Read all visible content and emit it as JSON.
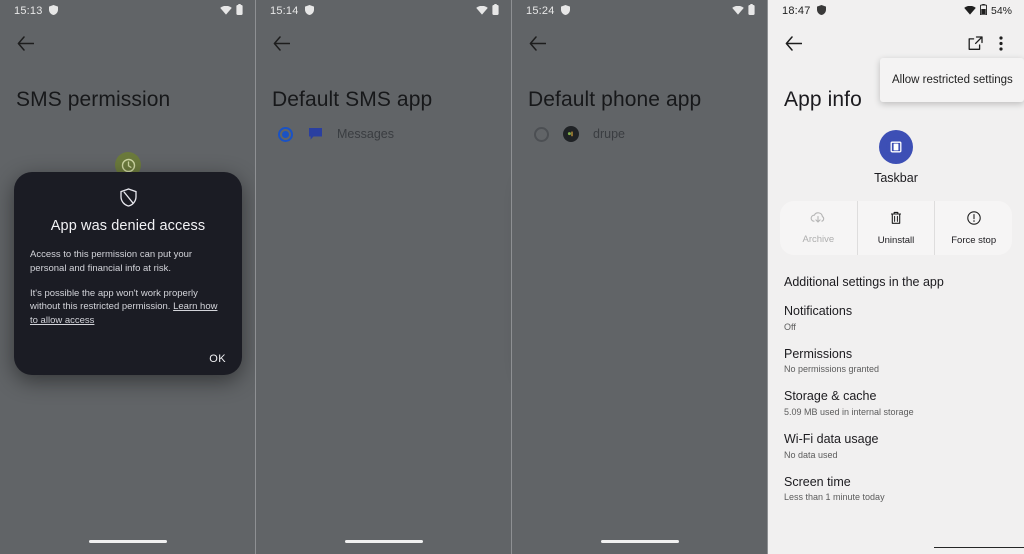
{
  "dialog": {
    "title": "App was denied access",
    "paragraph1": "Access to this permission can put your personal and financial info at risk.",
    "paragraph2_pre": "It's possible the app won't work properly without this restricted permission. ",
    "link": "Learn how to allow access",
    "ok_label": "OK"
  },
  "panels": [
    {
      "status": {
        "time": "15:13",
        "battery_pct": ""
      },
      "title": "SMS permission"
    },
    {
      "status": {
        "time": "15:14",
        "battery_pct": ""
      },
      "title": "Default SMS app",
      "option": {
        "label": "Messages",
        "selected": true
      }
    },
    {
      "status": {
        "time": "15:24",
        "battery_pct": ""
      },
      "title": "Default phone app",
      "option": {
        "label": "drupe",
        "selected": false
      }
    },
    {
      "status": {
        "time": "18:47",
        "battery_pct": "54%"
      },
      "title": "App info",
      "popup_menu_item": "Allow restricted settings",
      "app_name": "Taskbar",
      "actions": [
        {
          "label": "Archive",
          "disabled": true
        },
        {
          "label": "Uninstall",
          "disabled": false
        },
        {
          "label": "Force stop",
          "disabled": false
        }
      ],
      "section_header": "Additional settings in the app",
      "settings": [
        {
          "title": "Notifications",
          "subtitle": "Off"
        },
        {
          "title": "Permissions",
          "subtitle": "No permissions granted"
        },
        {
          "title": "Storage & cache",
          "subtitle": "5.09 MB used in internal storage"
        },
        {
          "title": "Wi-Fi data usage",
          "subtitle": "No data used"
        },
        {
          "title": "Screen time",
          "subtitle": "Less than 1 minute today"
        }
      ]
    }
  ],
  "icons": {
    "back": "back-arrow-icon",
    "wifi": "wifi-icon",
    "battery": "battery-icon",
    "vpn": "vpn-shield-icon",
    "shield_denied": "shield-denied-icon",
    "open_external": "open-in-new-icon",
    "overflow": "overflow-menu-icon",
    "archive": "cloud-archive-icon",
    "uninstall": "trash-icon",
    "force_stop": "stop-circle-icon"
  },
  "colors": {
    "dim_background": "#616467",
    "light_background": "#f1f0f0",
    "dialog_background": "#1b1c24",
    "accent_blue": "#1a52c4",
    "app_icon_blue": "#3d4fb5"
  }
}
